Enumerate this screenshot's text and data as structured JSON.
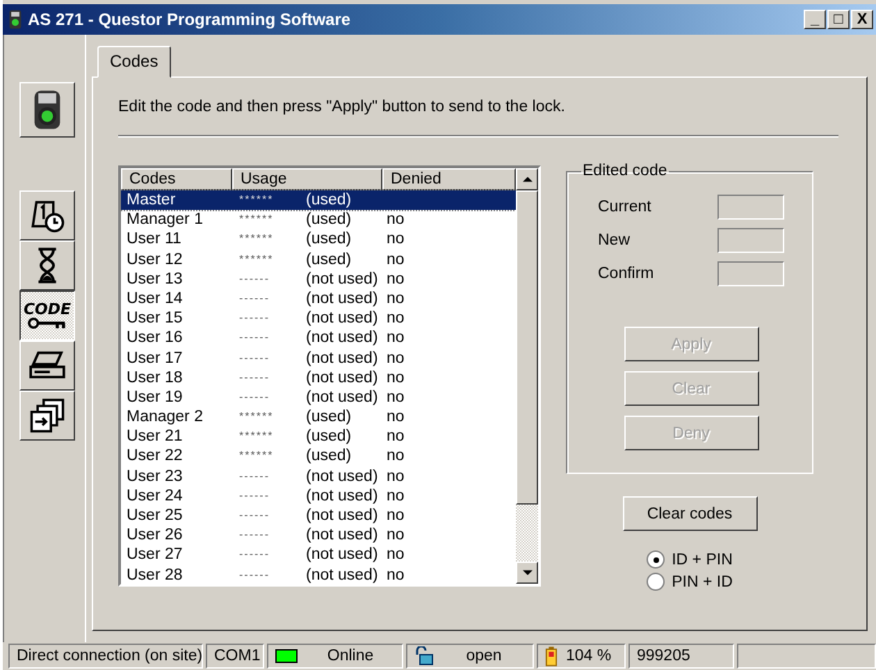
{
  "window": {
    "title": "AS 271 - Questor Programming Software",
    "controls": [
      "_",
      "□",
      "X"
    ]
  },
  "sidebar": {
    "top": {
      "kind": "device",
      "selected": false
    },
    "items": [
      {
        "kind": "calendar",
        "selected": false
      },
      {
        "kind": "hourglass",
        "selected": false
      },
      {
        "kind": "code",
        "label": "CODE",
        "selected": true
      },
      {
        "kind": "printer",
        "selected": false
      },
      {
        "kind": "transfer",
        "selected": false
      }
    ]
  },
  "tabs": [
    {
      "label": "Codes",
      "selected": true
    }
  ],
  "instruction": "Edit the code and then press \"Apply\" button to send to the lock.",
  "table": {
    "columns": [
      "Codes",
      "Usage",
      "Denied"
    ],
    "rows": [
      {
        "code": "Master",
        "usage": "******",
        "status": "(used)",
        "denied": "",
        "selected": true
      },
      {
        "code": "Manager 1",
        "usage": "******",
        "status": "(used)",
        "denied": "no",
        "selected": false
      },
      {
        "code": "User 11",
        "usage": "******",
        "status": "(used)",
        "denied": "no",
        "selected": false
      },
      {
        "code": "User 12",
        "usage": "******",
        "status": "(used)",
        "denied": "no",
        "selected": false
      },
      {
        "code": "User 13",
        "usage": "------",
        "status": "(not used)",
        "denied": "no",
        "selected": false
      },
      {
        "code": "User 14",
        "usage": "------",
        "status": "(not used)",
        "denied": "no",
        "selected": false
      },
      {
        "code": "User 15",
        "usage": "------",
        "status": "(not used)",
        "denied": "no",
        "selected": false
      },
      {
        "code": "User 16",
        "usage": "------",
        "status": "(not used)",
        "denied": "no",
        "selected": false
      },
      {
        "code": "User 17",
        "usage": "------",
        "status": "(not used)",
        "denied": "no",
        "selected": false
      },
      {
        "code": "User 18",
        "usage": "------",
        "status": "(not used)",
        "denied": "no",
        "selected": false
      },
      {
        "code": "User 19",
        "usage": "------",
        "status": "(not used)",
        "denied": "no",
        "selected": false
      },
      {
        "code": "Manager 2",
        "usage": "******",
        "status": "(used)",
        "denied": "no",
        "selected": false
      },
      {
        "code": "User 21",
        "usage": "******",
        "status": "(used)",
        "denied": "no",
        "selected": false
      },
      {
        "code": "User 22",
        "usage": "******",
        "status": "(used)",
        "denied": "no",
        "selected": false
      },
      {
        "code": "User 23",
        "usage": "------",
        "status": "(not used)",
        "denied": "no",
        "selected": false
      },
      {
        "code": "User 24",
        "usage": "------",
        "status": "(not used)",
        "denied": "no",
        "selected": false
      },
      {
        "code": "User 25",
        "usage": "------",
        "status": "(not used)",
        "denied": "no",
        "selected": false
      },
      {
        "code": "User 26",
        "usage": "------",
        "status": "(not used)",
        "denied": "no",
        "selected": false
      },
      {
        "code": "User 27",
        "usage": "------",
        "status": "(not used)",
        "denied": "no",
        "selected": false
      },
      {
        "code": "User 28",
        "usage": "------",
        "status": "(not used)",
        "denied": "no",
        "selected": false
      }
    ]
  },
  "edited_code": {
    "title": "Edited code",
    "fields": [
      {
        "label": "Current"
      },
      {
        "label": "New"
      },
      {
        "label": "Confirm"
      }
    ],
    "buttons": [
      {
        "label": "Apply",
        "disabled": true
      },
      {
        "label": "Clear",
        "disabled": true
      },
      {
        "label": "Deny",
        "disabled": true
      }
    ]
  },
  "clear_codes_button": {
    "label": "Clear codes",
    "disabled": false
  },
  "mode": [
    {
      "label": "ID + PIN",
      "selected": true
    },
    {
      "label": "PIN + ID",
      "selected": false
    }
  ],
  "status_bar": [
    {
      "kind": "text",
      "text": "Direct connection (on site)"
    },
    {
      "kind": "text",
      "text": "COM1"
    },
    {
      "kind": "led",
      "text": "Online",
      "color": "#00ff00"
    },
    {
      "kind": "lock",
      "text": "open"
    },
    {
      "kind": "battery",
      "text": "104 %"
    },
    {
      "kind": "text",
      "text": "999205"
    },
    {
      "kind": "empty"
    }
  ]
}
